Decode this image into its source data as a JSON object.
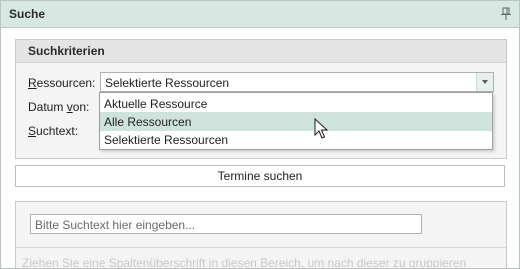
{
  "panel": {
    "title": "Suche",
    "pin_icon": "pin-icon"
  },
  "criteria": {
    "header": "Suchkriterien",
    "resources_label_first": "R",
    "resources_label_rest": "essourcen:",
    "date_label_pre": "Datum ",
    "date_label_u": "v",
    "date_label_post": "on:",
    "search_label_first": "S",
    "search_label_rest": "uchtext:",
    "resources_value": "Selektierte Ressourcen",
    "dropdown_options": [
      "Aktuelle Ressource",
      "Alle Ressourcen",
      "Selektierte Ressourcen"
    ],
    "hovered_option": "Alle Ressourcen"
  },
  "search_button": "Termine suchen",
  "results": {
    "search_placeholder": "Bitte Suchtext hier eingeben...",
    "group_hint": "Ziehen Sie eine Spaltenüberschrift in diesen Bereich, um nach dieser zu gruppieren"
  }
}
